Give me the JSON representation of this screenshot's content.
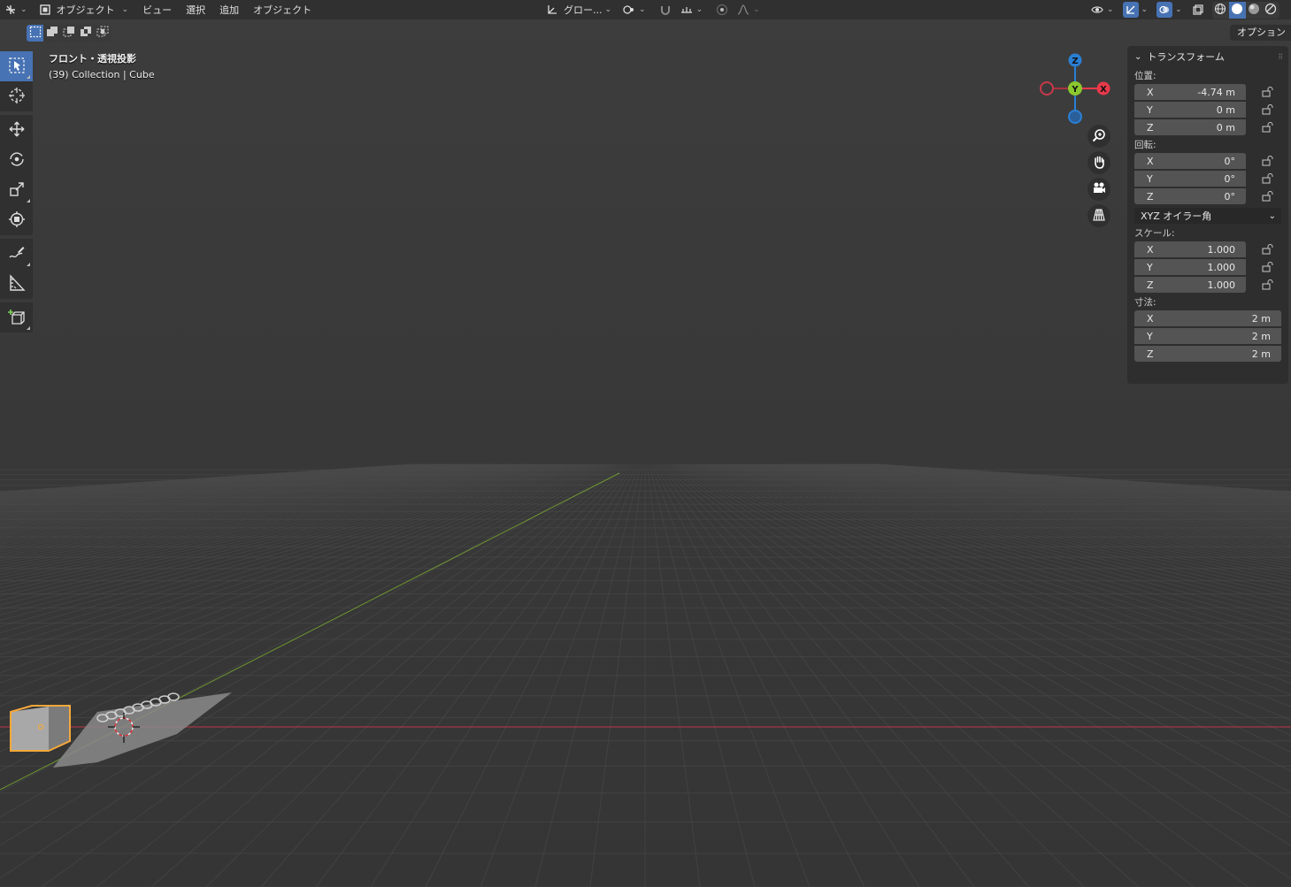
{
  "header": {
    "mode_label": "オブジェクト",
    "menus": [
      "ビュー",
      "選択",
      "追加",
      "オブジェクト"
    ],
    "orientation_label": "グロー..."
  },
  "options_tab": "オプション",
  "view_info": {
    "view_name": "フロント・透視投影",
    "collection": "(39) Collection | Cube"
  },
  "gizmo": {
    "z": "Z",
    "y": "Y",
    "x": "X"
  },
  "transform_panel": {
    "title": "トランスフォーム",
    "location": {
      "label": "位置:",
      "x": "-4.74 m",
      "y": "0 m",
      "z": "0 m"
    },
    "rotation": {
      "label": "回転:",
      "x": "0°",
      "y": "0°",
      "z": "0°",
      "mode": "XYZ オイラー角"
    },
    "scale": {
      "label": "スケール:",
      "x": "1.000",
      "y": "1.000",
      "z": "1.000"
    },
    "dimensions": {
      "label": "寸法:",
      "x": "2 m",
      "y": "2 m",
      "z": "2 m"
    },
    "axis_labels": [
      "X",
      "Y",
      "Z"
    ]
  },
  "colors": {
    "accent": "#4772b3",
    "x_axis": "#e8394a",
    "y_axis": "#8bc72e",
    "z_axis": "#2a7fd4",
    "selection": "#f5a83a"
  }
}
